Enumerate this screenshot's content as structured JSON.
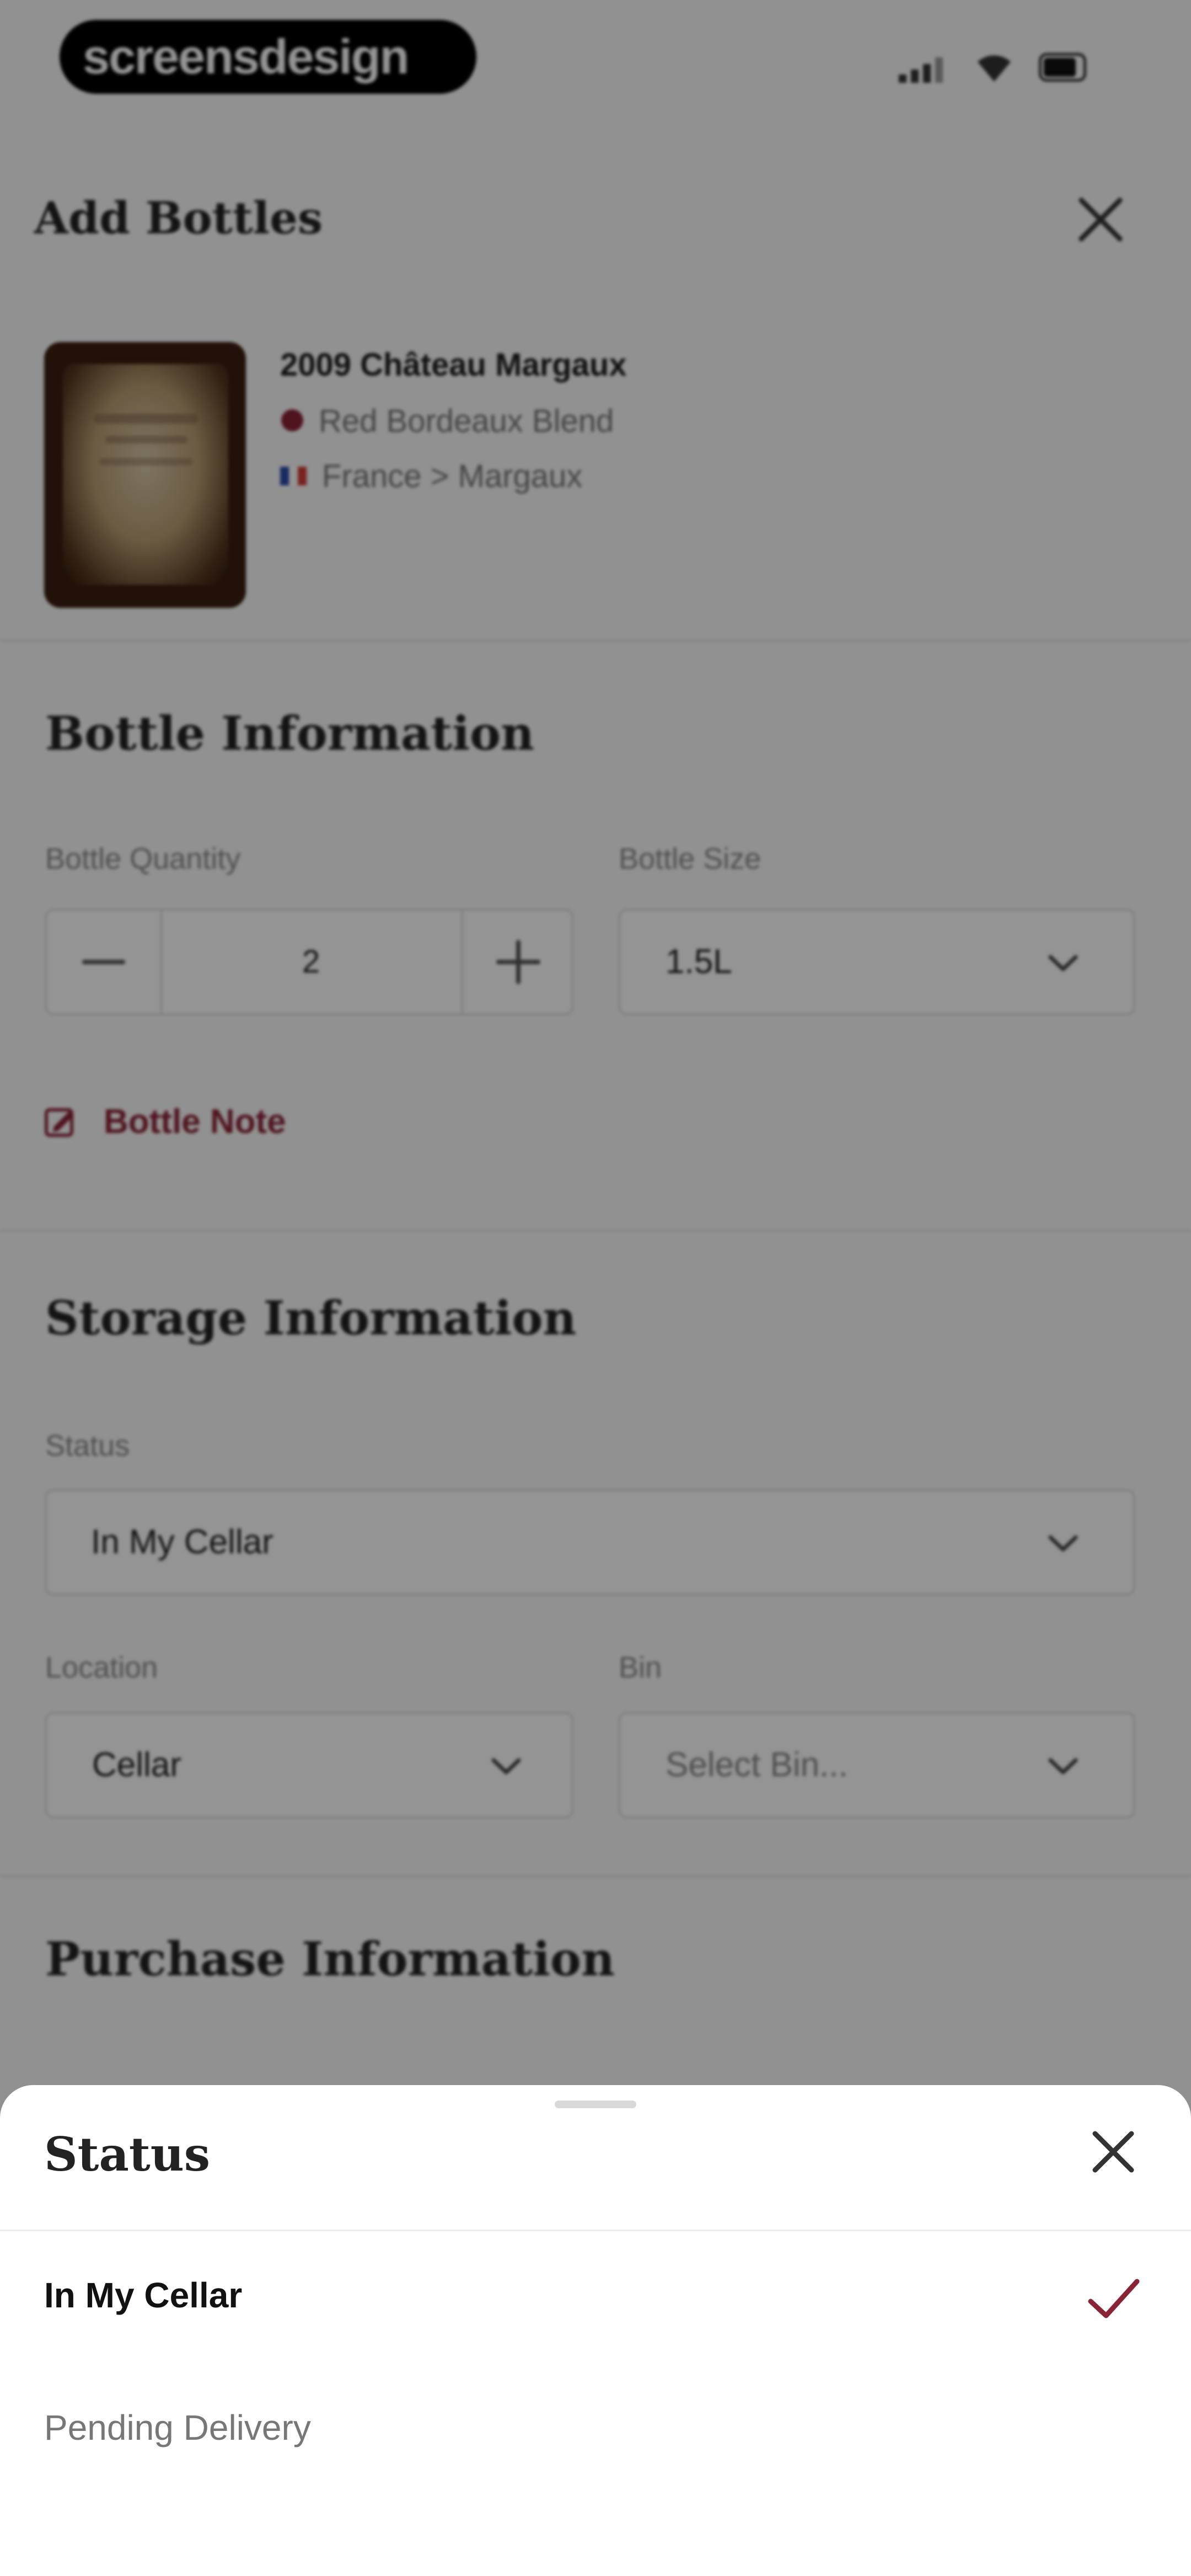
{
  "status_bar": {
    "brand": "screensdesign"
  },
  "header": {
    "title": "Add Bottles"
  },
  "wine": {
    "name": "2009 Château Margaux",
    "type": "Red Bordeaux Blend",
    "region": "France > Margaux",
    "type_dot_color": "#8a2336"
  },
  "bottle_info": {
    "section_title": "Bottle Information",
    "quantity_label": "Bottle Quantity",
    "quantity_value": "2",
    "size_label": "Bottle Size",
    "size_value": "1.5L",
    "note_label": "Bottle Note"
  },
  "storage_info": {
    "section_title": "Storage Information",
    "status_label": "Status",
    "status_value": "In My Cellar",
    "location_label": "Location",
    "location_value": "Cellar",
    "bin_label": "Bin",
    "bin_placeholder": "Select Bin..."
  },
  "purchase_info": {
    "section_title": "Purchase Information"
  },
  "status_sheet": {
    "title": "Status",
    "options": [
      {
        "label": "In My Cellar",
        "selected": true
      },
      {
        "label": "Pending Delivery",
        "selected": false
      }
    ]
  },
  "colors": {
    "accent": "#8a2336",
    "overlay": "rgba(0,0,0,0.42)"
  }
}
